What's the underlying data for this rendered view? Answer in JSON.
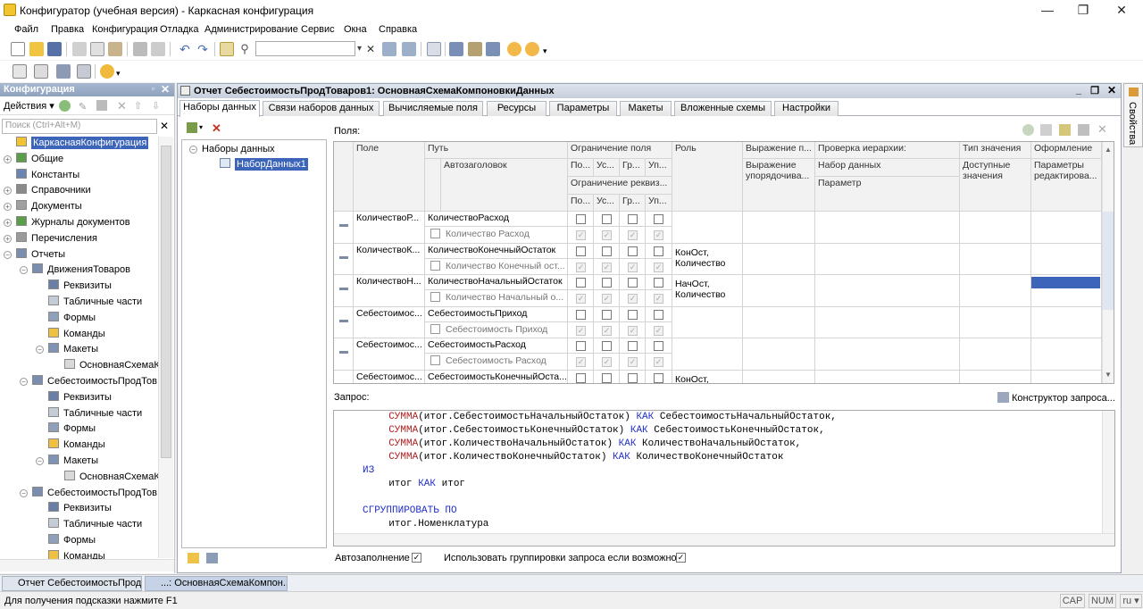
{
  "window": {
    "title": "Конфигуратор (учебная версия) - Каркасная конфигурация",
    "min": "—",
    "max": "❐",
    "close": "✕"
  },
  "menu": [
    "Файл",
    "Правка",
    "Конфигурация",
    "Отладка",
    "Администрирование",
    "Сервис",
    "Окна",
    "Справка"
  ],
  "config_panel": {
    "title": "Конфигурация",
    "actions_label": "Действия ▾",
    "search_placeholder": "Поиск (Ctrl+Alt+M)",
    "tree": [
      {
        "label": "КаркаснаяКонфигурация",
        "selected": true
      },
      {
        "label": "Общие"
      },
      {
        "label": "Константы"
      },
      {
        "label": "Справочники"
      },
      {
        "label": "Документы"
      },
      {
        "label": "Журналы документов"
      },
      {
        "label": "Перечисления"
      },
      {
        "label": "Отчеты"
      },
      {
        "label": "ДвиженияТоваров"
      },
      {
        "label": "Реквизиты"
      },
      {
        "label": "Табличные части"
      },
      {
        "label": "Формы"
      },
      {
        "label": "Команды"
      },
      {
        "label": "Макеты"
      },
      {
        "label": "ОсновнаяСхемаК"
      },
      {
        "label": "СебестоимостьПродТов"
      },
      {
        "label": "Реквизиты"
      },
      {
        "label": "Табличные части"
      },
      {
        "label": "Формы"
      },
      {
        "label": "Команды"
      },
      {
        "label": "Макеты"
      },
      {
        "label": "ОсновнаяСхемаК"
      },
      {
        "label": "СебестоимостьПродТов"
      },
      {
        "label": "Реквизиты"
      },
      {
        "label": "Табличные части"
      },
      {
        "label": "Формы"
      },
      {
        "label": "Команды"
      }
    ]
  },
  "main_window": {
    "title": "Отчет СебестоимостьПродТоваров1: ОсновнаяСхемаКомпоновкиДанных",
    "tabs": [
      "Наборы данных",
      "Связи наборов данных",
      "Вычисляемые поля",
      "Ресурсы",
      "Параметры",
      "Макеты",
      "Вложенные схемы",
      "Настройки"
    ],
    "datasets_root": "Наборы данных",
    "dataset": "НаборДанных1",
    "fields_label": "Поля:",
    "headers": {
      "field": "Поле",
      "path": "Путь",
      "title": "Автозаголовок",
      "restriction": "Ограничение поля",
      "restriction_req": "Ограничение реквиз...",
      "r1": "По...",
      "r2": "Ус...",
      "r3": "Гр...",
      "r4": "Уп...",
      "role": "Роль",
      "expr": "Выражение п...",
      "expr_sub": "Выражение упорядочива...",
      "hier": "Проверка иерархии:",
      "hier_sub": "Набор данных",
      "hier_param": "Параметр",
      "type": "Тип значения",
      "type_sub": "Доступные значения",
      "format": "Оформление",
      "format_sub": "Параметры редактирова..."
    },
    "rows": [
      {
        "field": "КоличествоР...",
        "path": "КоличествоРасход",
        "title": "Количество Расход",
        "role": ""
      },
      {
        "field": "КоличествоК...",
        "path": "КоличествоКонечныйОстаток",
        "title": "Количество Конечный ост...",
        "role": "КонОст, Количество"
      },
      {
        "field": "КоличествоН...",
        "path": "КоличествоНачальныйОстаток",
        "title": "Количество Начальный о...",
        "role": "НачОст, Количество"
      },
      {
        "field": "Себестоимос...",
        "path": "СебестоимостьПриход",
        "title": "Себестоимость Приход",
        "role": ""
      },
      {
        "field": "Себестоимос...",
        "path": "СебестоимостьРасход",
        "title": "Себестоимость Расход",
        "role": ""
      },
      {
        "field": "Себестоимос...",
        "path": "СебестоимостьКонечныйОста...",
        "title": "",
        "role": "КонОст,"
      }
    ],
    "query_label": "Запрос:",
    "query_builder": "Конструктор запроса...",
    "query_lines": [
      {
        "i": 4,
        "parts": [
          [
            "fn",
            "СУММА"
          ],
          [
            "",
            "(итог.СебестоимостьНачальныйОстаток) "
          ],
          [
            "kw",
            "КАК"
          ],
          [
            "",
            " СебестоимостьНачальныйОстаток,"
          ]
        ]
      },
      {
        "i": 4,
        "parts": [
          [
            "fn",
            "СУММА"
          ],
          [
            "",
            "(итог.СебестоимостьКонечныйОстаток) "
          ],
          [
            "kw",
            "КАК"
          ],
          [
            "",
            " СебестоимостьКонечныйОстаток,"
          ]
        ]
      },
      {
        "i": 4,
        "parts": [
          [
            "fn",
            "СУММА"
          ],
          [
            "",
            "(итог.КоличествоНачальныйОстаток) "
          ],
          [
            "kw",
            "КАК"
          ],
          [
            "",
            " КоличествоНачальныйОстаток,"
          ]
        ]
      },
      {
        "i": 4,
        "parts": [
          [
            "fn",
            "СУММА"
          ],
          [
            "",
            "(итог.КоличествоКонечныйОстаток) "
          ],
          [
            "kw",
            "КАК"
          ],
          [
            "",
            " КоличествоКонечныйОстаток"
          ]
        ]
      },
      {
        "i": 0,
        "parts": [
          [
            "kw",
            "ИЗ"
          ]
        ]
      },
      {
        "i": 4,
        "parts": [
          [
            "",
            "итог "
          ],
          [
            "kw",
            "КАК"
          ],
          [
            "",
            " итог"
          ]
        ]
      },
      {
        "i": 0,
        "parts": [
          [
            "",
            ""
          ]
        ]
      },
      {
        "i": 0,
        "parts": [
          [
            "kw",
            "СГРУППИРОВАТЬ ПО"
          ]
        ]
      },
      {
        "i": 4,
        "parts": [
          [
            "",
            "итог.Номенклатура"
          ]
        ]
      }
    ],
    "autofill_label": "Автозаполнение",
    "group_label": "Использовать группировки запроса если возможно"
  },
  "right_bar": "Свойства",
  "taskbar": [
    "Отчет СебестоимостьПрод...",
    "...: ОсновнаяСхемаКомпон..."
  ],
  "status": {
    "hint": "Для получения подсказки нажмите F1",
    "cap": "CAP",
    "num": "NUM",
    "lang": "ru ▾"
  },
  "colors": {
    "selected": "#3c65ba",
    "accent": "#1f2ec9"
  }
}
